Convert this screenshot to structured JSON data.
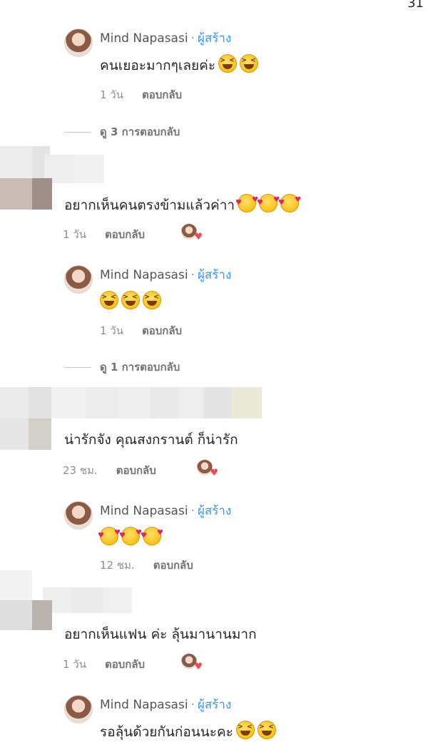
{
  "corner_text": "31",
  "author": {
    "name": "Mind Napasasi",
    "separator": "·",
    "badge": "ผู้สร้าง"
  },
  "reply_label": "ตอบกลับ",
  "threads": [
    {
      "text": "คนเยอะมากๆเลยค่ะ",
      "emojis": [
        "grinning-squinting",
        "grinning-squinting"
      ],
      "time": "1 วัน",
      "view_replies": "ดู 3 การตอบกลับ"
    },
    {
      "comment": "อยากเห็นคนตรงข้ามแล้วค่าา",
      "emojis": [
        "smiling-face-with-hearts",
        "smiling-face-with-hearts",
        "smiling-face-with-hearts"
      ],
      "time": "1 วัน"
    },
    {
      "text": "",
      "emojis": [
        "grinning-squinting",
        "grinning-squinting",
        "grinning-squinting"
      ],
      "time": "1 วัน",
      "view_replies": "ดู 1 การตอบกลับ"
    },
    {
      "comment": "น่ารักจัง คุณสงกรานต์ ก็น่ารัก",
      "time": "23 ชม."
    },
    {
      "text": "",
      "emojis": [
        "smiling-face-with-hearts",
        "smiling-face-with-hearts",
        "smiling-face-with-hearts"
      ],
      "time": "12 ชม."
    },
    {
      "comment": "อยากเห็นแฟน ค่ะ ลุ้นมานานมาก",
      "time": "1 วัน"
    },
    {
      "text": "รอลุ้นด้วยกันก่อนนะคะ",
      "emojis": [
        "grinning-squinting",
        "grinning-squinting"
      ]
    }
  ]
}
